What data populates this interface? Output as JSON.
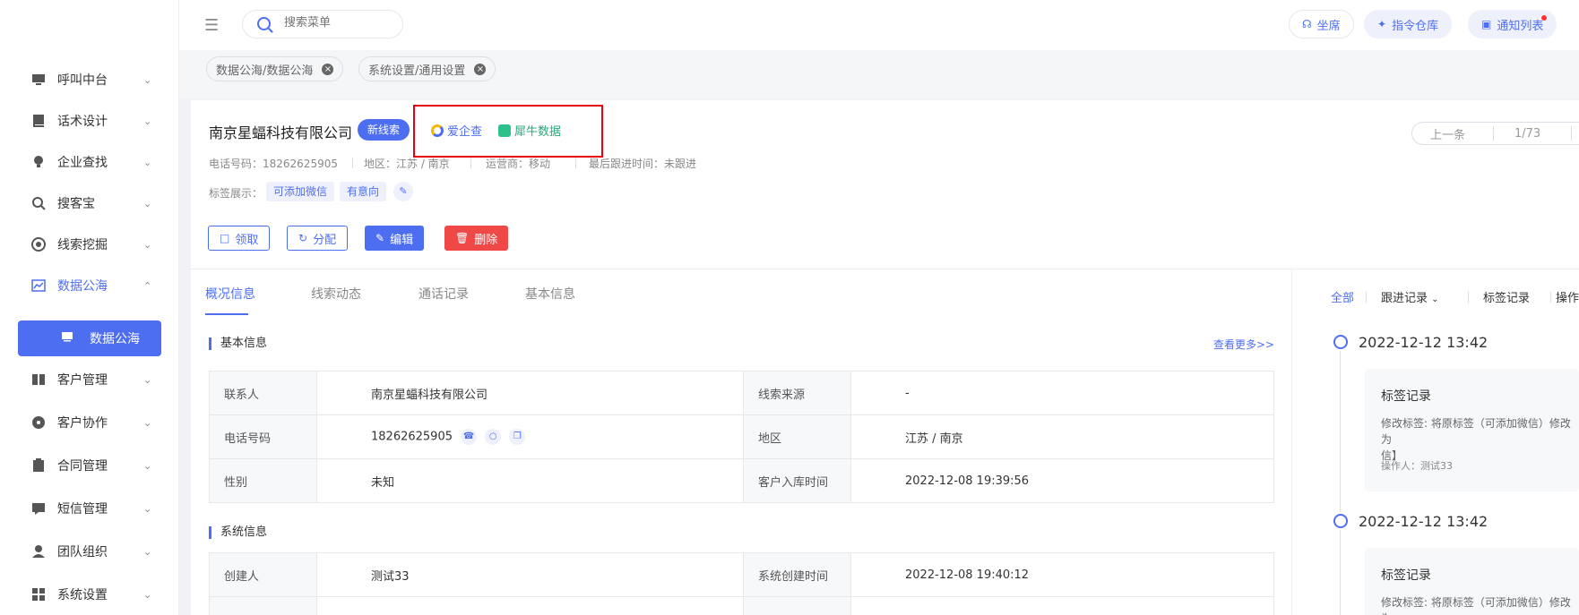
{
  "sidebar": {
    "items": [
      {
        "label": "呼叫中台",
        "icon": "monitor-icon"
      },
      {
        "label": "话术设计",
        "icon": "book-icon"
      },
      {
        "label": "企业查找",
        "icon": "bulb-icon"
      },
      {
        "label": "搜客宝",
        "icon": "search-zoom-icon"
      },
      {
        "label": "线索挖掘",
        "icon": "target-icon"
      },
      {
        "label": "数据公海",
        "icon": "chart-icon"
      },
      {
        "label": "客户管理",
        "icon": "customer-icon"
      },
      {
        "label": "客户协作",
        "icon": "collab-icon"
      },
      {
        "label": "合同管理",
        "icon": "contract-icon"
      },
      {
        "label": "短信管理",
        "icon": "sms-icon"
      },
      {
        "label": "团队组织",
        "icon": "team-icon"
      },
      {
        "label": "系统设置",
        "icon": "settings-grid-icon"
      }
    ],
    "sub_item": "数据公海"
  },
  "topbar": {
    "search_placeholder": "搜索菜单",
    "btn_seat": "坐席",
    "btn_command": "指令仓库",
    "btn_notice": "通知列表"
  },
  "tags": [
    "数据公海/数据公海",
    "系统设置/通用设置"
  ],
  "header": {
    "company": "南京星蝠科技有限公司",
    "badge": "新线索",
    "link1": "爱企查",
    "link2": "犀牛数据",
    "phone": "电话号码：18262625905",
    "region": "地区：江苏 / 南京",
    "carrier": "运营商：移动",
    "last_follow": "最后跟进时间：未跟进",
    "tags_label": "标签展示：",
    "tag1": "可添加微信",
    "tag2": "有意向",
    "pager_prev": "上一条",
    "pager_count": "1/73"
  },
  "actions": {
    "claim": "领取",
    "assign": "分配",
    "edit": "编辑",
    "delete": "删除"
  },
  "tabs": [
    "概况信息",
    "线索动态",
    "通话记录",
    "基本信息"
  ],
  "basic_info": {
    "title": "基本信息",
    "more": "查看更多>>",
    "rows": [
      [
        "联系人",
        "南京星蝠科技有限公司",
        "线索来源",
        "-"
      ],
      [
        "电话号码",
        "18262625905",
        "地区",
        "江苏 / 南京"
      ],
      [
        "性别",
        "未知",
        "客户入库时间",
        "2022-12-08 19:39:56"
      ]
    ]
  },
  "system_info": {
    "title": "系统信息",
    "rows": [
      [
        "创建人",
        "测试33",
        "系统创建时间",
        "2022-12-08 19:40:12"
      ]
    ]
  },
  "right_panel": {
    "tabs": [
      "全部",
      "跟进记录",
      "标签记录",
      "操作"
    ],
    "timeline": [
      {
        "date": "2022-12-12    13:42",
        "title": "标签记录",
        "desc": "修改标签: 将原标签（可添加微信）修改为【可添加微信】",
        "desc_line1": "修改标签: 将原标签（可添加微信）修改为",
        "desc_line2": "信】",
        "op": "操作人：测试33"
      },
      {
        "date": "2022-12-12    13:42",
        "title": "标签记录",
        "desc_line1": "修改标签: 将原标签（可添加微信）修改为"
      }
    ]
  },
  "colors": {
    "primary": "#4e6ef2",
    "danger": "#f04747",
    "highlight_box": "#e60012"
  }
}
